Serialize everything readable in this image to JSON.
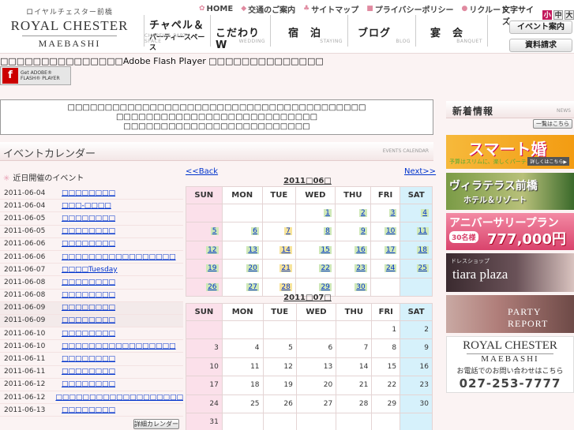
{
  "header": {
    "logo_kana": "ロイヤルチェスター前橋",
    "logo_main": "ROYAL CHESTER",
    "logo_sub": "MAEBASHI",
    "top_links": [
      {
        "label": "HOME",
        "icon": "flower-icon"
      },
      {
        "label": "交通のご案内",
        "icon": "car-icon"
      },
      {
        "label": "サイトマップ",
        "icon": "sitemap-icon"
      },
      {
        "label": "プライバシーポリシー",
        "icon": "lock-icon"
      },
      {
        "label": "リクルート",
        "icon": "person-icon"
      }
    ],
    "font_size_label": "文字サイズ",
    "font_sizes": [
      "小",
      "中",
      "大"
    ],
    "main_nav": [
      {
        "l1": "チャペル＆",
        "l2": "パーティースペース",
        "en": "CHAPEL & PARTY SPACE"
      },
      {
        "l1": "こだわりW",
        "l2": "",
        "en": "WEDDING"
      },
      {
        "l1": "宿　泊",
        "l2": "",
        "en": "STAYING"
      },
      {
        "l1": "ブログ",
        "l2": "",
        "en": "BLOG"
      },
      {
        "l1": "宴　会",
        "l2": "",
        "en": "BANQUET"
      }
    ],
    "event_button": "イベント案内",
    "request_button": "資料請求"
  },
  "flash": {
    "message": "□□□□□□□□□□□□□□□Adobe Flash Player □□□□□□□□□□□□□□",
    "button_line1": "Get ADOBE®",
    "button_line2": "FLASH® PLAYER"
  },
  "notice": [
    "□□□□□□□□□□□□□□□□□□□□□□□□□□□□□□□□□□□□□□□□",
    "□□□□□□□□□□□□□□□□□□□□□□□□□□□",
    "□□□□□□□□□□□□□□□□□□□□□□□□□"
  ],
  "event_calendar": {
    "title": "イベントカレンダー",
    "title_en": "EVENTS CALENDAR",
    "upcoming_label": "近日開催のイベント",
    "events": [
      {
        "date": "2011-06-04",
        "title": "□□□□□□□□"
      },
      {
        "date": "2011-06-04",
        "title": "□□□-□□□□"
      },
      {
        "date": "2011-06-05",
        "title": "□□□□□□□□"
      },
      {
        "date": "2011-06-05",
        "title": "□□□□□□□□"
      },
      {
        "date": "2011-06-06",
        "title": "□□□□□□□□"
      },
      {
        "date": "2011-06-06",
        "title": "□□□□□□□□□□□□□□□□□"
      },
      {
        "date": "2011-06-07",
        "title": "□□□□Tuesday"
      },
      {
        "date": "2011-06-08",
        "title": "□□□□□□□□"
      },
      {
        "date": "2011-06-08",
        "title": "□□□□□□□□"
      },
      {
        "date": "2011-06-09",
        "title": "□□□□□□□□"
      },
      {
        "date": "2011-06-09",
        "title": "□□□□□□□□"
      },
      {
        "date": "2011-06-10",
        "title": "□□□□□□□□"
      },
      {
        "date": "2011-06-10",
        "title": "□□□□□□□□□□□□□□□□□"
      },
      {
        "date": "2011-06-11",
        "title": "□□□□□□□□"
      },
      {
        "date": "2011-06-11",
        "title": "□□□□□□□□"
      },
      {
        "date": "2011-06-12",
        "title": "□□□□□□□□"
      },
      {
        "date": "2011-06-12",
        "title": "□□□□□□□□□□□□□□□□□□□"
      },
      {
        "date": "2011-06-13",
        "title": "□□□□□□□□"
      }
    ],
    "detail_button": "詳細カレンダー",
    "back": "<<Back",
    "next": "Next>>",
    "weekdays": [
      "SUN",
      "MON",
      "TUE",
      "WED",
      "THU",
      "FRI",
      "SAT"
    ],
    "months": [
      {
        "label": "2011□06□",
        "weeks": [
          [
            "",
            "",
            "",
            "1",
            "2",
            "3",
            "4"
          ],
          [
            "5",
            "6",
            "7",
            "8",
            "9",
            "10",
            "11"
          ],
          [
            "12",
            "13",
            "14",
            "15",
            "16",
            "17",
            "18"
          ],
          [
            "19",
            "20",
            "21",
            "22",
            "23",
            "24",
            "25"
          ],
          [
            "26",
            "27",
            "28",
            "29",
            "30",
            "",
            ""
          ]
        ]
      },
      {
        "label": "2011□07□",
        "weeks": [
          [
            "",
            "",
            "",
            "",
            "",
            "1",
            "2"
          ],
          [
            "3",
            "4",
            "5",
            "6",
            "7",
            "8",
            "9"
          ],
          [
            "10",
            "11",
            "12",
            "13",
            "14",
            "15",
            "16"
          ],
          [
            "17",
            "18",
            "19",
            "20",
            "21",
            "22",
            "23"
          ],
          [
            "24",
            "25",
            "26",
            "27",
            "28",
            "29",
            "30"
          ],
          [
            "31",
            "",
            "",
            "",
            "",
            "",
            ""
          ]
        ]
      }
    ],
    "june_event_days_green": [
      "1",
      "2",
      "3",
      "4",
      "5",
      "6",
      "8",
      "9",
      "10",
      "11",
      "12",
      "13",
      "15",
      "16",
      "17",
      "18",
      "19",
      "20",
      "22",
      "23",
      "24",
      "25",
      "26",
      "27",
      "29",
      "30"
    ],
    "june_event_days_yellow": [
      "7",
      "14",
      "21",
      "28"
    ]
  },
  "sidebar": {
    "news_title": "新着情報",
    "news_en": "NEWS",
    "list_button": "一覧はこちら",
    "banners": {
      "smart_title": "スマート婚",
      "smart_sub": "予算はスリムに、楽しくパーティー。",
      "smart_more": "詳しくはこちら▶",
      "villa_title": "ヴィラテラス前橋",
      "villa_sub": "ホテル＆リゾート",
      "anniv_title": "アニバーサリープラン",
      "anniv_badge": "30名様",
      "anniv_price": "777,000円",
      "tiara_small": "ドレスショップ",
      "tiara_title": "tiara plaza",
      "party_title": "PARTY REPORT",
      "contact_main": "ROYAL CHESTER",
      "contact_sub": "MAEBASHI",
      "contact_text": "お電話でのお問い合わせはこちら",
      "contact_phone": "027-253-7777"
    }
  }
}
